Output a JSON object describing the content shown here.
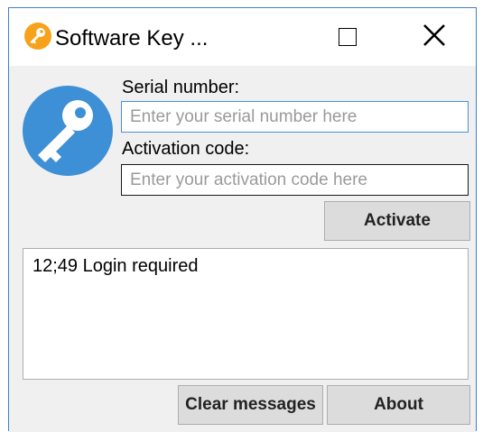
{
  "window": {
    "title": "Software Key ...",
    "border_color": "#3f7fd0"
  },
  "titlebar": {
    "app_icon": "key-icon",
    "maximize_icon": "maximize-icon",
    "close_icon": "close-icon"
  },
  "form": {
    "serial_label": "Serial number:",
    "serial_value": "",
    "serial_placeholder": "Enter your serial number here",
    "activation_label": "Activation code:",
    "activation_value": "",
    "activation_placeholder": "Enter your activation code here",
    "activate_label": "Activate"
  },
  "messages": {
    "lines": [
      "12;49 Login required"
    ]
  },
  "footer": {
    "clear_label": "Clear messages",
    "about_label": "About"
  },
  "colors": {
    "badge_blue": "#3d8fd6",
    "icon_orange": "#f7a21b",
    "client_bg": "#f0f0f0"
  }
}
